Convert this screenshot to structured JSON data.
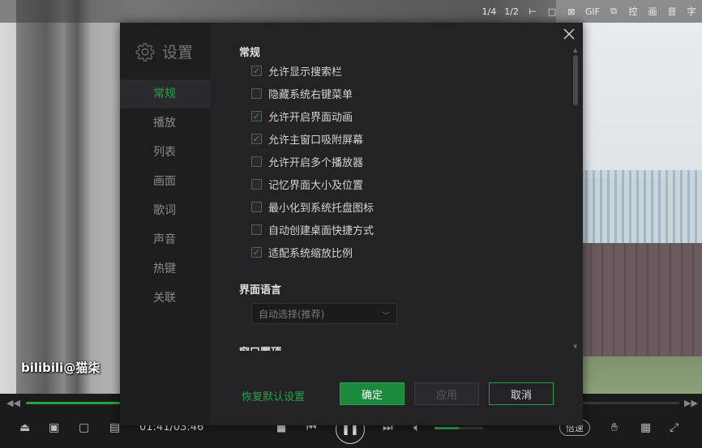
{
  "top_toolbar": {
    "items": [
      "1/4",
      "1/2",
      "⊢",
      "□",
      "⊠",
      "GIF",
      "⧉",
      "控",
      "画",
      "音",
      "字"
    ]
  },
  "overlay": {
    "watermark": "bilibili@猫柒"
  },
  "settings": {
    "title": "设置",
    "nav": [
      {
        "label": "常规",
        "active": true
      },
      {
        "label": "播放",
        "active": false
      },
      {
        "label": "列表",
        "active": false
      },
      {
        "label": "画面",
        "active": false
      },
      {
        "label": "歌词",
        "active": false
      },
      {
        "label": "声音",
        "active": false
      },
      {
        "label": "热键",
        "active": false
      },
      {
        "label": "关联",
        "active": false
      }
    ],
    "general": {
      "section_title": "常规",
      "options": [
        {
          "label": "允许显示搜索栏",
          "checked": true
        },
        {
          "label": "隐藏系统右键菜单",
          "checked": false
        },
        {
          "label": "允许开启界面动画",
          "checked": true
        },
        {
          "label": "允许主窗口吸附屏幕",
          "checked": true
        },
        {
          "label": "允许开启多个播放器",
          "checked": false
        },
        {
          "label": "记忆界面大小及位置",
          "checked": false
        },
        {
          "label": "最小化到系统托盘图标",
          "checked": false
        },
        {
          "label": "自动创建桌面快捷方式",
          "checked": false
        },
        {
          "label": "适配系统缩放比例",
          "checked": true
        }
      ]
    },
    "language": {
      "section_title": "界面语言",
      "selected": "自动选择(推荐)"
    },
    "next_section_title": "窗口置顶",
    "footer": {
      "restore_label": "恢复默认设置",
      "ok_label": "确定",
      "apply_label": "应用",
      "cancel_label": "取消"
    }
  },
  "player": {
    "time": "01:41/03:46",
    "progress": 0.42,
    "volume": 0.5,
    "speed_label": "倍速"
  },
  "colors": {
    "accent": "#27a148",
    "dialog_bg": "#232326",
    "nav_bg": "#1e1e21"
  }
}
